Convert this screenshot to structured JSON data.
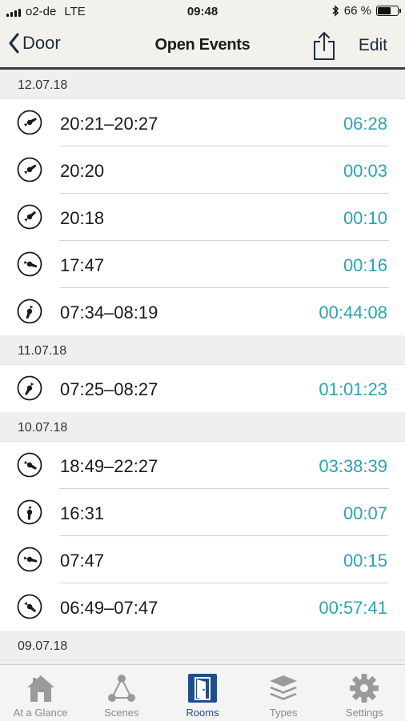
{
  "status": {
    "carrier": "o2-de",
    "network": "LTE",
    "time": "09:48",
    "battery": "66 %",
    "battery_level": 0.66
  },
  "nav": {
    "back_label": "Door",
    "title": "Open Events",
    "edit_label": "Edit"
  },
  "sections": [
    {
      "date": "12.07.18",
      "events": [
        {
          "time": "20:21–20:27",
          "duration": "06:28",
          "angle": -30
        },
        {
          "time": "20:20",
          "duration": "00:03",
          "angle": -35
        },
        {
          "time": "20:18",
          "duration": "00:10",
          "angle": -40
        },
        {
          "time": "17:47",
          "duration": "00:16",
          "angle": 20
        },
        {
          "time": "07:34–08:19",
          "duration": "00:44:08",
          "angle": 110
        }
      ]
    },
    {
      "date": "11.07.18",
      "events": [
        {
          "time": "07:25–08:27",
          "duration": "01:01:23",
          "angle": 120
        }
      ]
    },
    {
      "date": "10.07.18",
      "events": [
        {
          "time": "18:49–22:27",
          "duration": "03:38:39",
          "angle": 30
        },
        {
          "time": "16:31",
          "duration": "00:07",
          "angle": 95
        },
        {
          "time": "07:47",
          "duration": "00:15",
          "angle": 15
        },
        {
          "time": "06:49–07:47",
          "duration": "00:57:41",
          "angle": 40
        }
      ]
    },
    {
      "date": "09.07.18",
      "events": []
    }
  ],
  "tabs": [
    {
      "label": "At a Glance",
      "icon": "house-icon"
    },
    {
      "label": "Scenes",
      "icon": "scenes-icon"
    },
    {
      "label": "Rooms",
      "icon": "door-icon",
      "active": true
    },
    {
      "label": "Types",
      "icon": "layers-icon"
    },
    {
      "label": "Settings",
      "icon": "gear-icon"
    }
  ],
  "colors": {
    "accent": "#2aa3b3",
    "active_tab": "#1f4e8c",
    "nav_text": "#1f2a44"
  }
}
